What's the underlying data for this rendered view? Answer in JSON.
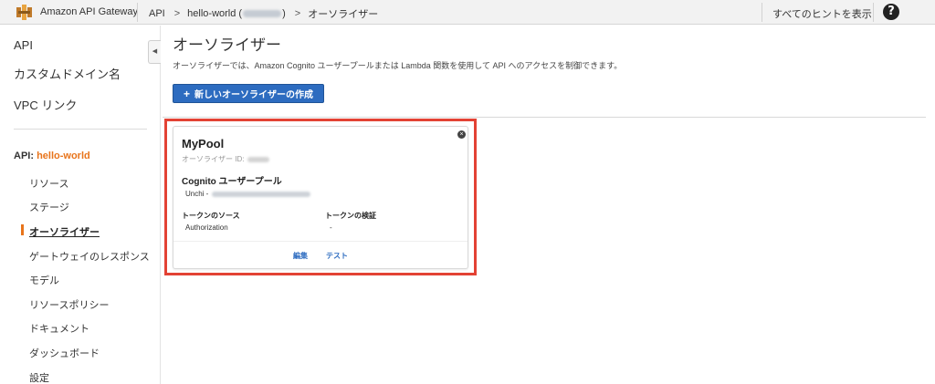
{
  "header": {
    "title": "Amazon API Gateway",
    "breadcrumb": [
      "API",
      "hello-world (",
      "オーソライザー"
    ],
    "breadcrumb_close": ")",
    "hint": "すべてのヒントを表示",
    "help": "?"
  },
  "sidebar": {
    "top_items": [
      {
        "label": "API"
      },
      {
        "label": "カスタムドメイン名"
      },
      {
        "label": "VPC リンク"
      }
    ],
    "api_prefix": "API: ",
    "api_name": "hello-world",
    "sub_items": [
      {
        "label": "リソース"
      },
      {
        "label": "ステージ"
      },
      {
        "label": "オーソライザー",
        "active": true
      },
      {
        "label": "ゲートウェイのレスポンス"
      },
      {
        "label": "モデル"
      },
      {
        "label": "リソースポリシー"
      },
      {
        "label": "ドキュメント"
      },
      {
        "label": "ダッシュボード"
      },
      {
        "label": "設定"
      }
    ],
    "collapse_icon": "◀"
  },
  "main": {
    "title": "オーソライザー",
    "description": "オーソライザーでは、Amazon Cognito ユーザープールまたは Lambda 関数を使用して API へのアクセスを制御できます。",
    "create_button": "新しいオーソライザーの作成",
    "create_icon": "+"
  },
  "card": {
    "title": "MyPool",
    "id_label": "オーソライザー ID:",
    "pool_label": "Cognito ユーザープール",
    "pool_value_prefix": "Unchi - ",
    "token_source_label": "トークンのソース",
    "token_source_value": "Authorization",
    "token_validation_label": "トークンの検証",
    "token_validation_value": "-",
    "edit": "編集",
    "test": "テスト",
    "close_icon": "×"
  },
  "colors": {
    "accent_orange": "#e8741b",
    "button_blue": "#2d6cc0",
    "highlight_red": "#e34234"
  }
}
